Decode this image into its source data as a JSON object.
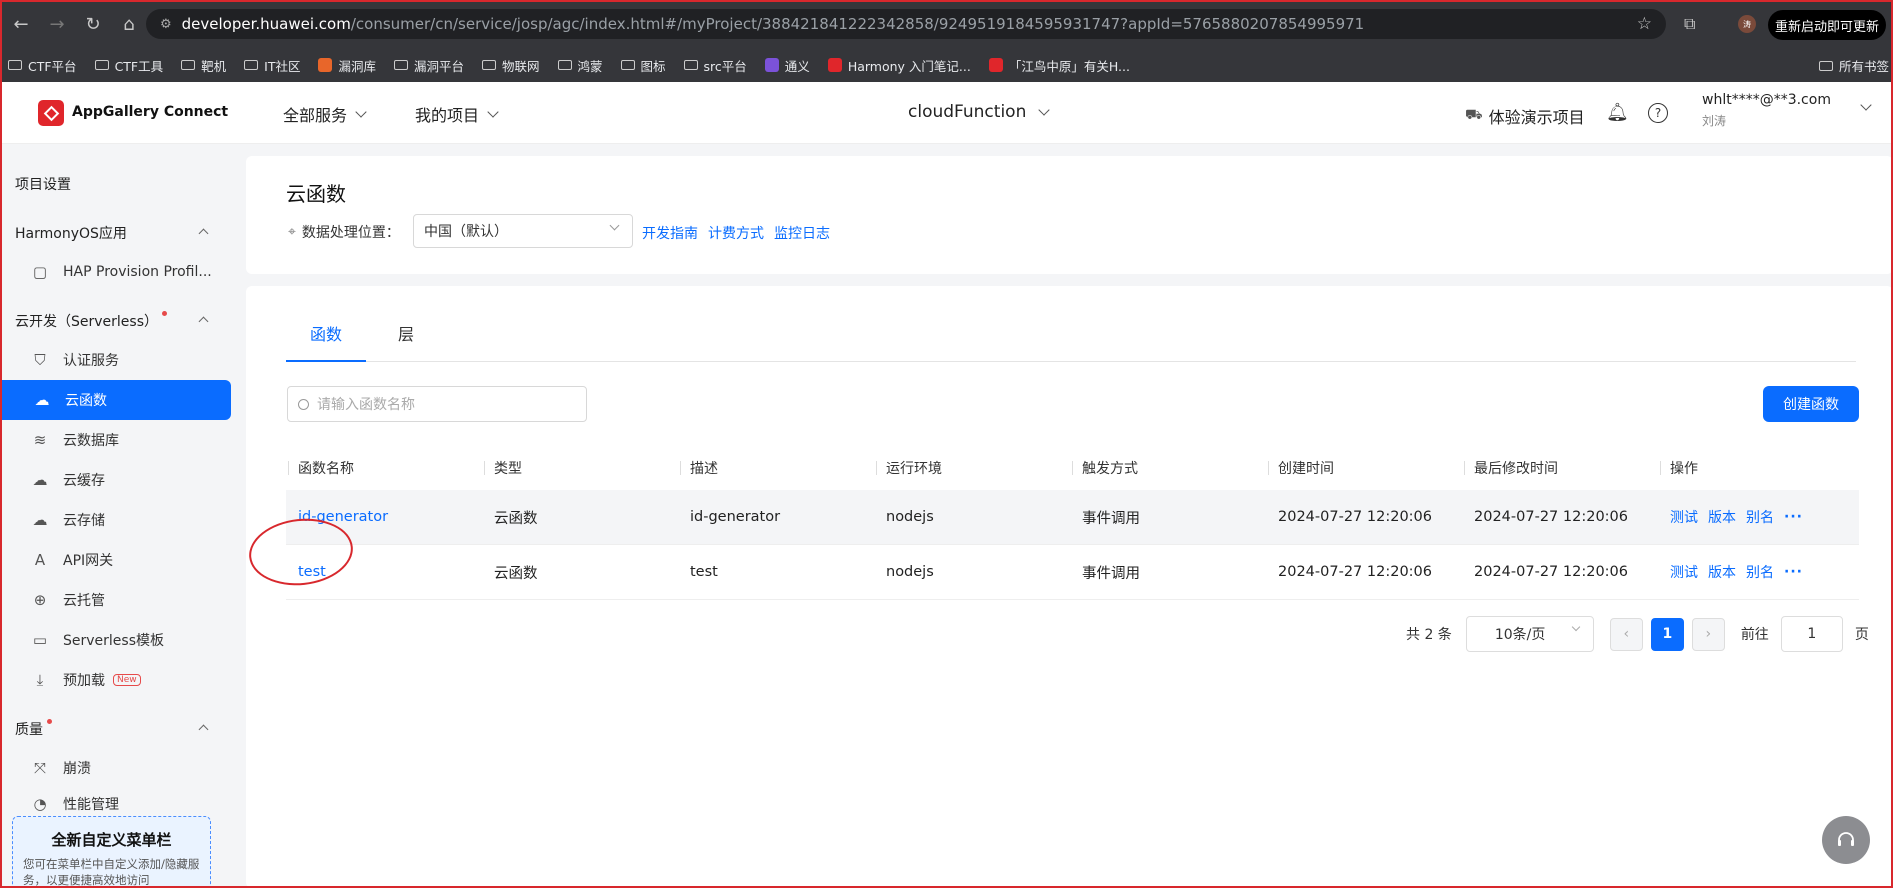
{
  "browser": {
    "url_host": "developer.huawei.com",
    "url_path": "/consumer/cn/service/josp/agc/index.html#/myProject/388421841222342858/9249519184595931747?appId=5765880207854995971",
    "profile_initial": "涛",
    "update_label": "重新启动即可更新",
    "bookmarks": [
      {
        "label": "CTF平台",
        "icon": "folder-icon"
      },
      {
        "label": "CTF工具",
        "icon": "folder-icon"
      },
      {
        "label": "靶机",
        "icon": "folder-icon"
      },
      {
        "label": "IT社区",
        "icon": "folder-icon"
      },
      {
        "label": "漏洞库",
        "icon": "favicon"
      },
      {
        "label": "漏洞平台",
        "icon": "folder-icon"
      },
      {
        "label": "物联网",
        "icon": "folder-icon"
      },
      {
        "label": "鸿蒙",
        "icon": "folder-icon"
      },
      {
        "label": "图标",
        "icon": "folder-icon"
      },
      {
        "label": "src平台",
        "icon": "folder-icon"
      },
      {
        "label": "通义",
        "icon": "favicon"
      },
      {
        "label": "Harmony 入门笔记...",
        "icon": "favicon"
      },
      {
        "label": "「江鸟中原」有关H...",
        "icon": "favicon"
      }
    ],
    "all_bookmarks_label": "所有书签"
  },
  "header": {
    "brand": "AppGallery Connect",
    "all_services": "全部服务",
    "my_projects": "我的项目",
    "project_name": "cloudFunction",
    "demo_project": "体验演示项目",
    "user_account": "whlt****@**3.com",
    "user_name": "刘涛"
  },
  "sidebar": {
    "project_settings": "项目设置",
    "harmony_section": "HarmonyOS应用",
    "hap_profile": "HAP Provision Profil...",
    "serverless_section": "云开发（Serverless）",
    "items": [
      {
        "label": "认证服务",
        "icon": "shield-icon"
      },
      {
        "label": "云函数",
        "icon": "cloud-function-icon",
        "active": true
      },
      {
        "label": "云数据库",
        "icon": "database-icon"
      },
      {
        "label": "云缓存",
        "icon": "cache-icon"
      },
      {
        "label": "云存储",
        "icon": "storage-icon"
      },
      {
        "label": "API网关",
        "icon": "api-gateway-icon"
      },
      {
        "label": "云托管",
        "icon": "globe-icon"
      },
      {
        "label": "Serverless模板",
        "icon": "template-icon"
      },
      {
        "label": "预加载",
        "icon": "preload-icon",
        "badge": "New"
      }
    ],
    "quality_section": "质量",
    "crash_item": "崩溃",
    "perf_item": "性能管理",
    "promo_title": "全新自定义菜单栏",
    "promo_desc": "您可在菜单栏中自定义添加/隐藏服务，以更便捷高效地访问"
  },
  "main": {
    "title": "云函数",
    "location_label": "数据处理位置：",
    "location_value": "中国（默认）",
    "links": [
      "开发指南",
      "计费方式",
      "监控日志"
    ],
    "tabs": [
      "函数",
      "层"
    ],
    "search_placeholder": "请输入函数名称",
    "create_button": "创建函数",
    "columns": [
      "函数名称",
      "类型",
      "描述",
      "运行环境",
      "触发方式",
      "创建时间",
      "最后修改时间",
      "操作"
    ],
    "rows": [
      [
        "id-generator",
        "云函数",
        "id-generator",
        "nodejs",
        "事件调用",
        "2024-07-27 12:20:06",
        "2024-07-27 12:20:06"
      ],
      [
        "test",
        "云函数",
        "test",
        "nodejs",
        "事件调用",
        "2024-07-27 12:20:06",
        "2024-07-27 12:20:06"
      ]
    ],
    "row_actions": [
      "测试",
      "版本",
      "别名"
    ],
    "pager": {
      "total": "共 2 条",
      "page_size": "10条/页",
      "current": "1",
      "goto_label": "前往",
      "goto_value": "1",
      "unit": "页"
    }
  },
  "colors": {
    "accent": "#0a6cff",
    "brand_red": "#e0262b",
    "annotation_red": "#d8282d"
  }
}
